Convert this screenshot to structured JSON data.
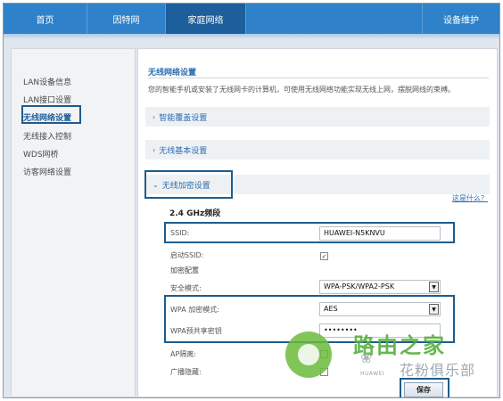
{
  "topnav": {
    "tabs": [
      {
        "label": "首页"
      },
      {
        "label": "因特网"
      },
      {
        "label": "家庭网络"
      },
      {
        "label": "设备维护"
      }
    ]
  },
  "sidebar": {
    "items": [
      {
        "label": "LAN设备信息"
      },
      {
        "label": "LAN接口设置"
      },
      {
        "label": "无线网络设置"
      },
      {
        "label": "无线接入控制"
      },
      {
        "label": "WDS网桥"
      },
      {
        "label": "访客网络设置"
      }
    ]
  },
  "main": {
    "title": "无线网络设置",
    "description": "您的智能手机或安装了无线网卡的计算机，可使用无线网络功能实现无线上网，摆脱网线的束缚。",
    "sections": [
      {
        "label": "智能覆盖设置",
        "chevron": "›"
      },
      {
        "label": "无线基本设置",
        "chevron": "›"
      },
      {
        "label": "无线加密设置",
        "chevron": "⌄"
      }
    ],
    "help_link": "这是什么？",
    "band_title": "2.4 GHz频段",
    "form": {
      "ssid_label": "SSID:",
      "ssid_value": "HUAWEI-N5KNVU",
      "enable_ssid_label": "启动SSID:",
      "enable_ssid_checked": "✓",
      "encryption_group": "加密配置",
      "security_mode_label": "安全模式:",
      "security_mode_value": "WPA-PSK/WPA2-PSK",
      "wpa_mode_label": "WPA 加密模式:",
      "wpa_mode_value": "AES",
      "wpa_key_label": "WPA预共享密钥",
      "wpa_key_value": "••••••••",
      "ap_isolation_label": "AP隔离:",
      "broadcast_hide_label": "广播隐藏:",
      "dropdown_arrow": "▼"
    },
    "save_label": "保存"
  },
  "watermark": {
    "main": "路由之家",
    "sub": "花粉俱乐部",
    "brand": "HUAWEI",
    "flower": "❀"
  }
}
